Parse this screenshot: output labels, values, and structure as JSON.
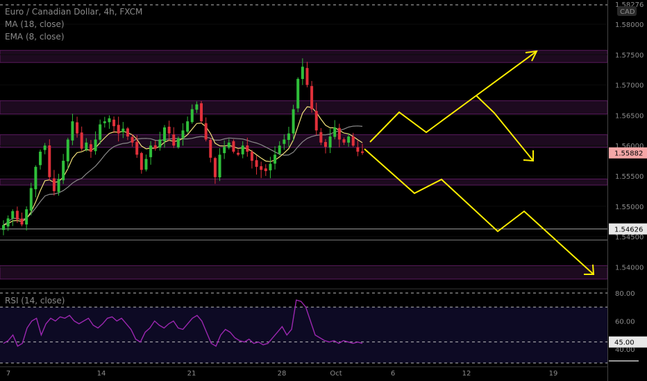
{
  "chart_data": {
    "type": "candlestick",
    "symbol": "Euro / Canadian Dollar, 4h, FXCM",
    "indicators": [
      "MA (18, close)",
      "EMA (8, close)"
    ],
    "currency_badge": "CAD",
    "y_ticks": [
      "1.58000",
      "1.57500",
      "1.57000",
      "1.56500",
      "1.56000",
      "1.55500",
      "1.55000",
      "1.54500",
      "1.54000"
    ],
    "y_top_label": "1.58276",
    "price_label": "1.55882",
    "level_label": "1.54626",
    "x_ticks": [
      "7",
      "14",
      "21",
      "28",
      "Oct",
      "6",
      "12",
      "19"
    ],
    "ylim": [
      1.5365,
      1.584
    ],
    "close_path": [
      1.5469,
      1.548,
      1.5492,
      1.5478,
      1.547,
      1.5495,
      1.553,
      1.5565,
      1.559,
      1.56,
      1.5548,
      1.5525,
      1.5545,
      1.5575,
      1.561,
      1.564,
      1.562,
      1.5595,
      1.5605,
      1.559,
      1.561,
      1.5635,
      1.564,
      1.5645,
      1.5632,
      1.562,
      1.5628,
      1.5615,
      1.5605,
      1.5585,
      1.556,
      1.5578,
      1.56,
      1.5595,
      1.561,
      1.563,
      1.562,
      1.56,
      1.5612,
      1.5625,
      1.564,
      1.566,
      1.5668,
      1.564,
      1.561,
      1.558,
      1.5548,
      1.5585,
      1.5598,
      1.5605,
      1.559,
      1.5585,
      1.56,
      1.559,
      1.5575,
      1.5565,
      1.556,
      1.5558,
      1.557,
      1.5585,
      1.56,
      1.561,
      1.562,
      1.566,
      1.571,
      1.573,
      1.57,
      1.566,
      1.5625,
      1.5605,
      1.5598,
      1.5615,
      1.563,
      1.561,
      1.5605,
      1.5615,
      1.56,
      1.559,
      1.5588
    ],
    "zones": [
      [
        1.5737,
        1.5757
      ],
      [
        1.5652,
        1.5674
      ],
      [
        1.5597,
        1.5618
      ],
      [
        1.5535,
        1.5545
      ],
      [
        1.538,
        1.5402
      ]
    ],
    "level": 1.54626,
    "rsi": {
      "label": "RSI (14, close)",
      "ticks": [
        "80.00",
        "60.00",
        "45.00",
        "40.00"
      ],
      "ylim": [
        28,
        82
      ],
      "levels": [
        80,
        70,
        45,
        30
      ],
      "values": [
        44,
        46,
        50,
        42,
        44,
        55,
        60,
        62,
        50,
        58,
        62,
        60,
        63,
        62,
        64,
        60,
        58,
        60,
        62,
        57,
        55,
        58,
        62,
        63,
        60,
        62,
        58,
        54,
        47,
        45,
        52,
        55,
        60,
        57,
        55,
        58,
        60,
        55,
        54,
        58,
        62,
        64,
        60,
        52,
        44,
        42,
        50,
        54,
        52,
        48,
        46,
        45,
        47,
        44,
        45,
        43,
        44,
        48,
        52,
        56,
        50,
        54,
        75,
        74,
        70,
        60,
        50,
        48,
        46,
        45,
        46,
        44,
        46,
        45,
        44,
        45,
        44
      ]
    }
  }
}
